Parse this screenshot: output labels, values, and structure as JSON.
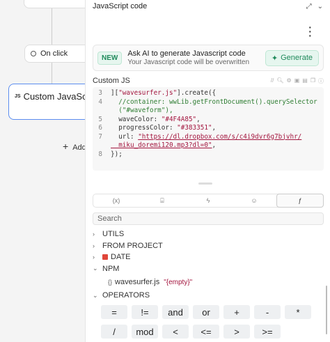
{
  "canvas": {
    "trigger_label": "On click",
    "action_label": "Custom JavaScript",
    "add_label": "Add"
  },
  "panel": {
    "title": "JavaScript code",
    "ai": {
      "badge": "NEW",
      "title": "Ask AI to generate Javascript code",
      "subtitle": "Your Javascript code will be overwritten",
      "button": "Generate"
    },
    "custom_js_label": "Custom JS",
    "code_lines": [
      {
        "n": "3",
        "parts": [
          {
            "t": "][",
            "c": "def"
          },
          {
            "t": "\"wavesurfer.js\"",
            "c": "str"
          },
          {
            "t": "].create({",
            "c": "def"
          }
        ]
      },
      {
        "n": "4",
        "parts": [
          {
            "t": "  //container: wwLib.getFrontDocument().querySelector",
            "c": "cmt"
          }
        ]
      },
      {
        "n": "",
        "parts": [
          {
            "t": "  (\"#waveform\"),",
            "c": "cmt"
          }
        ]
      },
      {
        "n": "5",
        "parts": [
          {
            "t": "  waveColor: ",
            "c": "def"
          },
          {
            "t": "\"#4F4A85\"",
            "c": "str"
          },
          {
            "t": ",",
            "c": "def"
          }
        ]
      },
      {
        "n": "6",
        "parts": [
          {
            "t": "  progressColor: ",
            "c": "def"
          },
          {
            "t": "\"#383351\"",
            "c": "str"
          },
          {
            "t": ",",
            "c": "def"
          }
        ]
      },
      {
        "n": "7",
        "parts": [
          {
            "t": "  url: ",
            "c": "def"
          },
          {
            "t": "\"https://dl.dropbox.com/s/c4i9dvr6g7bjvhr/",
            "c": "url"
          }
        ]
      },
      {
        "n": "",
        "parts": [
          {
            "t": "  miku_doremi120.mp3?dl=0\"",
            "c": "url"
          },
          {
            "t": ",",
            "c": "def"
          }
        ]
      },
      {
        "n": "8",
        "parts": [
          {
            "t": "});",
            "c": "def"
          }
        ]
      }
    ],
    "tabs": [
      "(x)",
      "db",
      "bolt",
      "user",
      "f"
    ],
    "search_placeholder": "Search",
    "tree": {
      "utils": "UTILS",
      "from_project": "FROM PROJECT",
      "date": "DATE",
      "npm": "NPM",
      "package_name": "wavesurfer.js",
      "package_value": "\"{empty}\"",
      "operators": "OPERATORS"
    },
    "operators": [
      "=",
      "!=",
      "and",
      "or",
      "+",
      "-",
      "*",
      "/",
      "mod",
      "<",
      "<=",
      ">",
      ">=",
      ""
    ]
  }
}
